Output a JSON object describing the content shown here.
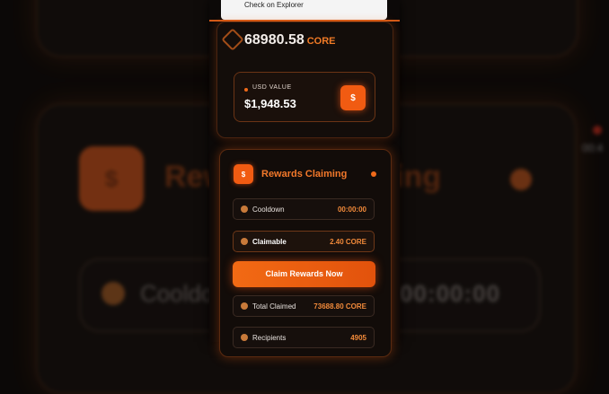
{
  "background": {
    "title_left": "Rew",
    "title_right": "ing",
    "cooldown_label": "Cooldo",
    "cooldown_time": "00:00:00",
    "side_time": "00:4",
    "dollar_symbol": "$"
  },
  "explorer_popup": {
    "label": "Check on Explorer"
  },
  "balance": {
    "amount": "68980.58",
    "unit": "CORE"
  },
  "usd": {
    "label": "USD VALUE",
    "value": "$1,948.53",
    "button_symbol": "$"
  },
  "rewards": {
    "icon_symbol": "$",
    "title": "Rewards Claiming",
    "cooldown": {
      "label": "Cooldown",
      "value": "00:00:00"
    },
    "claimable": {
      "label": "Claimable",
      "value": "2.40 CORE"
    },
    "claim_button": "Claim Rewards Now",
    "total_claimed": {
      "label": "Total Claimed",
      "value": "73688.80 CORE"
    },
    "recipients": {
      "label": "Recipients",
      "value": "4905"
    }
  },
  "colors": {
    "accent": "#f15b12",
    "accent_text": "#f2782a",
    "background": "#0b0807"
  }
}
